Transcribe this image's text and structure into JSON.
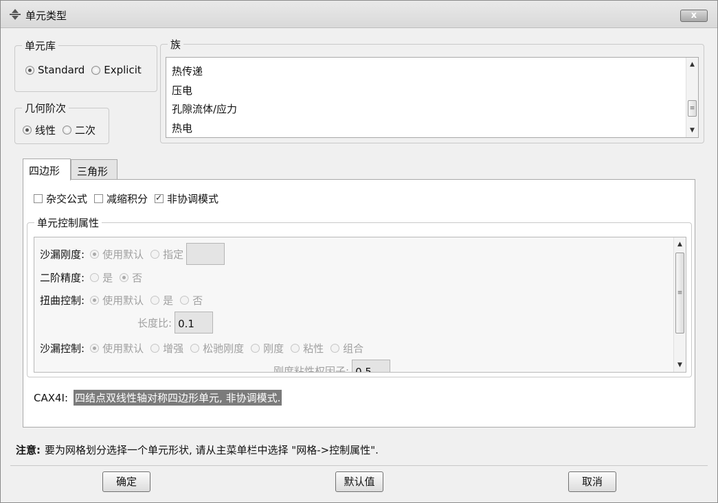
{
  "window": {
    "title": "单元类型",
    "close_label": "x"
  },
  "library": {
    "legend": "单元库",
    "options": [
      "Standard",
      "Explicit"
    ],
    "selected": "Standard"
  },
  "geometric_order": {
    "legend": "几何阶次",
    "options": [
      "线性",
      "二次"
    ],
    "selected": "线性"
  },
  "family": {
    "legend": "族",
    "items": [
      "热传递",
      "压电",
      "孔隙流体/应力",
      "热电"
    ]
  },
  "tabs": [
    {
      "label": "四边形",
      "active": true
    },
    {
      "label": "三角形",
      "active": false
    }
  ],
  "formulation": {
    "options": [
      {
        "label": "杂交公式",
        "checked": false
      },
      {
        "label": "减缩积分",
        "checked": false
      },
      {
        "label": "非协调模式",
        "checked": true
      }
    ]
  },
  "controls": {
    "legend": "单元控制属性",
    "hourglass_stiffness": {
      "label": "沙漏刚度:",
      "options": [
        "使用默认",
        "指定"
      ],
      "selected": "使用默认",
      "value": ""
    },
    "second_order_accuracy": {
      "label": "二阶精度:",
      "options": [
        "是",
        "否"
      ],
      "selected": "否"
    },
    "distortion_control": {
      "label": "扭曲控制:",
      "options": [
        "使用默认",
        "是",
        "否"
      ],
      "selected": "使用默认"
    },
    "length_ratio": {
      "label": "长度比:",
      "value": "0.1"
    },
    "hourglass_control": {
      "label": "沙漏控制:",
      "options": [
        "使用默认",
        "增强",
        "松驰刚度",
        "刚度",
        "粘性",
        "组合"
      ],
      "selected": "使用默认"
    },
    "stiffness_viscous_factor": {
      "label": "刚度粘性权因子:",
      "value": "0.5"
    }
  },
  "description": {
    "code": "CAX4I:",
    "text": "四结点双线性轴对称四边形单元, 非协调模式."
  },
  "note": {
    "prefix": "注意:",
    "text": "要为网格划分选择一个单元形状, 请从主菜单栏中选择 \"网格->控制属性\"."
  },
  "buttons": {
    "ok": "确定",
    "defaults": "默认值",
    "cancel": "取消"
  }
}
